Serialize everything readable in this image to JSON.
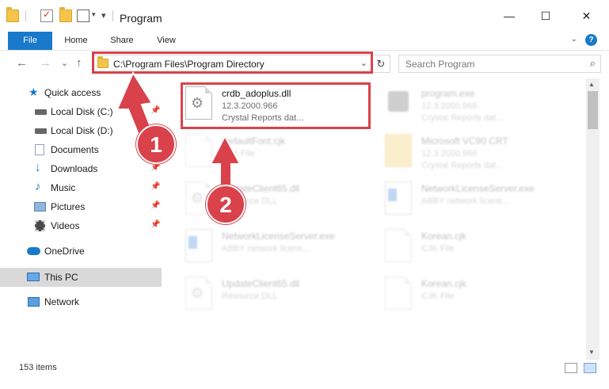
{
  "window": {
    "title": "Program",
    "minimize_glyph": "—",
    "maximize_glyph": "☐",
    "close_glyph": "✕",
    "qat_dropdown_glyph": "▾"
  },
  "ribbon": {
    "tabs": [
      {
        "label": "File"
      },
      {
        "label": "Home"
      },
      {
        "label": "Share"
      },
      {
        "label": "View"
      }
    ],
    "help_glyph": "?",
    "collapse_glyph": "⌄"
  },
  "navigation": {
    "back_glyph": "←",
    "forward_glyph": "→",
    "recent_glyph": "⌄",
    "up_glyph": "↑"
  },
  "address": {
    "path": "C:\\Program Files\\Program Directory",
    "dropdown_glyph": "⌄",
    "refresh_glyph": "↻"
  },
  "search": {
    "placeholder": "Search Program",
    "icon_glyph": "⌕"
  },
  "sidebar": {
    "pin_glyph": "📌",
    "items": [
      {
        "label": "Quick access",
        "icon": "star-icon",
        "pinned": false
      },
      {
        "label": "Local Disk (C:)",
        "icon": "drive-icon",
        "pinned": true
      },
      {
        "label": "Local Disk (D:)",
        "icon": "drive-icon",
        "pinned": false
      },
      {
        "label": "Documents",
        "icon": "documents-icon",
        "pinned": true
      },
      {
        "label": "Downloads",
        "icon": "download-icon",
        "pinned": true
      },
      {
        "label": "Music",
        "icon": "music-icon",
        "pinned": true
      },
      {
        "label": "Pictures",
        "icon": "pictures-icon",
        "pinned": true
      },
      {
        "label": "Videos",
        "icon": "videos-icon",
        "pinned": true
      },
      {
        "label": "OneDrive",
        "icon": "cloud-icon",
        "pinned": false
      },
      {
        "label": "This PC",
        "icon": "computer-icon",
        "pinned": false,
        "selected": true
      },
      {
        "label": "Network",
        "icon": "network-icon",
        "pinned": false
      }
    ]
  },
  "files": [
    {
      "name": "crdb_adoplus.dll",
      "version": "12.3.2000.966",
      "desc": "Crystal Reports dat...",
      "icon": "dll-gear-icon"
    },
    {
      "name": "program.exe",
      "version": "12.3.2000.966",
      "desc": "Crystal Reports dat...",
      "icon": "exe-icon"
    },
    {
      "name": "DefaultFont.cjk",
      "version": "CJK File",
      "desc": "",
      "icon": "file-icon"
    },
    {
      "name": "Microsoft VC90 CRT",
      "version": "12.3.2000.966",
      "desc": "Crystal Reports dat...",
      "icon": "folder-icon"
    },
    {
      "name": "UpdateClient65.dll",
      "version": "Resource DLL",
      "desc": "",
      "icon": "dll-gear-icon"
    },
    {
      "name": "NetworkLicenseServer.exe",
      "version": "ABBY network licens...",
      "desc": "",
      "icon": "window-app-icon"
    },
    {
      "name": "NetworkLicenseServer.exe",
      "version": "ABBY network licens...",
      "desc": "",
      "icon": "window-app-icon"
    },
    {
      "name": "Korean.cjk",
      "version": "CJK File",
      "desc": "",
      "icon": "file-icon"
    },
    {
      "name": "UpdateClient65.dll",
      "version": "Resource DLL",
      "desc": "",
      "icon": "dll-gear-icon"
    },
    {
      "name": "Korean.cjk",
      "version": "CJK File",
      "desc": "",
      "icon": "file-icon"
    }
  ],
  "scrollbar": {
    "up_glyph": "▲",
    "down_glyph": "▼"
  },
  "status": {
    "item_count": "153 items"
  },
  "annotations": [
    {
      "label": "1"
    },
    {
      "label": "2"
    }
  ],
  "colors": {
    "accent": "#1979ca",
    "annotation_red": "#d9424b",
    "folder_yellow": "#f4c54a"
  }
}
